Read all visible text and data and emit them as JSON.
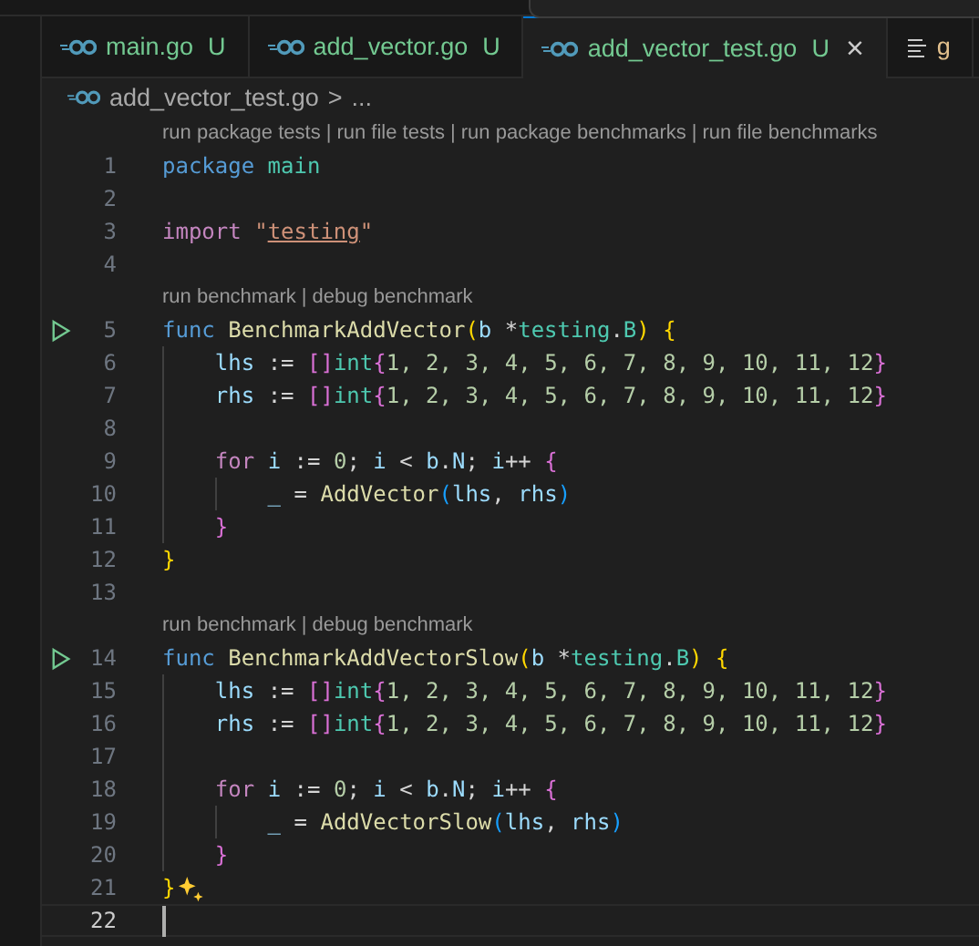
{
  "tabs": [
    {
      "label": "main.go",
      "status": "U",
      "selected": false,
      "kind": "go-file"
    },
    {
      "label": "add_vector.go",
      "status": "U",
      "selected": false,
      "kind": "go-file"
    },
    {
      "label": "add_vector_test.go",
      "status": "U",
      "selected": true,
      "kind": "go-file"
    },
    {
      "label": "g",
      "selected": false,
      "kind": "outline"
    }
  ],
  "close_glyph": "×",
  "breadcrumb": {
    "file": "add_vector_test.go",
    "separator": ">",
    "rest": "..."
  },
  "lens_separator": "|",
  "lines": [
    {
      "kind": "lens",
      "links": [
        "run package tests",
        "run file tests",
        "run package benchmarks",
        "run file benchmarks"
      ]
    },
    {
      "kind": "code",
      "number": "1",
      "current": false,
      "tokens": [
        {
          "text": "package",
          "kind": "keyword"
        },
        {
          "text": " main",
          "kind": "type"
        }
      ]
    },
    {
      "kind": "code",
      "number": "2",
      "current": false
    },
    {
      "kind": "code",
      "number": "3",
      "current": false,
      "tokens": [
        {
          "text": "import",
          "kind": "control"
        },
        {
          "text": " \"",
          "kind": "string"
        },
        {
          "text": "testing",
          "kind": "link"
        },
        {
          "text": "\"",
          "kind": "string"
        }
      ]
    },
    {
      "kind": "code",
      "number": "4",
      "current": false
    },
    {
      "kind": "lens",
      "links": [
        "run benchmark",
        "debug benchmark"
      ]
    },
    {
      "kind": "code",
      "number": "5",
      "runnable": true,
      "current": false,
      "tokens": [
        {
          "text": "func",
          "kind": "keyword"
        },
        {
          "text": " BenchmarkAddVector",
          "kind": "function"
        },
        {
          "text": "(",
          "kind": "bracket1"
        },
        {
          "text": "b",
          "kind": "variable"
        },
        {
          "text": " *",
          "kind": "op"
        },
        {
          "text": "testing",
          "kind": "type"
        },
        {
          "text": ".",
          "kind": "op"
        },
        {
          "text": "B",
          "kind": "type"
        },
        {
          "text": ")",
          "kind": "bracket1"
        },
        {
          "text": " {",
          "kind": "bracket1"
        }
      ]
    },
    {
      "kind": "code",
      "number": "6",
      "current": false,
      "tokens": [
        {
          "text": "    lhs",
          "kind": "variable"
        },
        {
          "text": " := ",
          "kind": "op"
        },
        {
          "text": "[]",
          "kind": "bracket2"
        },
        {
          "text": "int",
          "kind": "type"
        },
        {
          "text": "{",
          "kind": "bracket2"
        },
        {
          "text": "1, 2, 3, 4, 5, 6, 7, 8, 9, 10, 11, 12",
          "kind": "number"
        },
        {
          "text": "}",
          "kind": "bracket2"
        }
      ]
    },
    {
      "kind": "code",
      "number": "7",
      "current": false,
      "tokens": [
        {
          "text": "    rhs",
          "kind": "variable"
        },
        {
          "text": " := ",
          "kind": "op"
        },
        {
          "text": "[]",
          "kind": "bracket2"
        },
        {
          "text": "int",
          "kind": "type"
        },
        {
          "text": "{",
          "kind": "bracket2"
        },
        {
          "text": "1, 2, 3, 4, 5, 6, 7, 8, 9, 10, 11, 12",
          "kind": "number"
        },
        {
          "text": "}",
          "kind": "bracket2"
        }
      ]
    },
    {
      "kind": "code",
      "number": "8",
      "current": false
    },
    {
      "kind": "code",
      "number": "9",
      "current": false,
      "tokens": [
        {
          "text": "    for",
          "kind": "control"
        },
        {
          "text": " i",
          "kind": "variable"
        },
        {
          "text": " := ",
          "kind": "op"
        },
        {
          "text": "0",
          "kind": "number"
        },
        {
          "text": "; ",
          "kind": "op"
        },
        {
          "text": "i",
          "kind": "variable"
        },
        {
          "text": " < ",
          "kind": "op"
        },
        {
          "text": "b",
          "kind": "variable"
        },
        {
          "text": ".",
          "kind": "op"
        },
        {
          "text": "N",
          "kind": "variable"
        },
        {
          "text": "; ",
          "kind": "op"
        },
        {
          "text": "i",
          "kind": "variable"
        },
        {
          "text": "++ ",
          "kind": "op"
        },
        {
          "text": "{",
          "kind": "bracket2"
        }
      ]
    },
    {
      "kind": "code",
      "number": "10",
      "current": false,
      "tokens": [
        {
          "text": "        _",
          "kind": "variable"
        },
        {
          "text": " = ",
          "kind": "op"
        },
        {
          "text": "AddVector",
          "kind": "function"
        },
        {
          "text": "(",
          "kind": "bracket3"
        },
        {
          "text": "lhs",
          "kind": "variable"
        },
        {
          "text": ", ",
          "kind": "op"
        },
        {
          "text": "rhs",
          "kind": "variable"
        },
        {
          "text": ")",
          "kind": "bracket3"
        }
      ]
    },
    {
      "kind": "code",
      "number": "11",
      "current": false,
      "tokens": [
        {
          "text": "    }",
          "kind": "bracket2"
        }
      ]
    },
    {
      "kind": "code",
      "number": "12",
      "current": false,
      "tokens": [
        {
          "text": "}",
          "kind": "bracket1"
        }
      ]
    },
    {
      "kind": "code",
      "number": "13",
      "current": false
    },
    {
      "kind": "lens",
      "links": [
        "run benchmark",
        "debug benchmark"
      ]
    },
    {
      "kind": "code",
      "number": "14",
      "runnable": true,
      "current": false,
      "tokens": [
        {
          "text": "func",
          "kind": "keyword"
        },
        {
          "text": " BenchmarkAddVectorSlow",
          "kind": "function"
        },
        {
          "text": "(",
          "kind": "bracket1"
        },
        {
          "text": "b",
          "kind": "variable"
        },
        {
          "text": " *",
          "kind": "op"
        },
        {
          "text": "testing",
          "kind": "type"
        },
        {
          "text": ".",
          "kind": "op"
        },
        {
          "text": "B",
          "kind": "type"
        },
        {
          "text": ")",
          "kind": "bracket1"
        },
        {
          "text": " {",
          "kind": "bracket1"
        }
      ]
    },
    {
      "kind": "code",
      "number": "15",
      "current": false,
      "tokens": [
        {
          "text": "    lhs",
          "kind": "variable"
        },
        {
          "text": " := ",
          "kind": "op"
        },
        {
          "text": "[]",
          "kind": "bracket2"
        },
        {
          "text": "int",
          "kind": "type"
        },
        {
          "text": "{",
          "kind": "bracket2"
        },
        {
          "text": "1, 2, 3, 4, 5, 6, 7, 8, 9, 10, 11, 12",
          "kind": "number"
        },
        {
          "text": "}",
          "kind": "bracket2"
        }
      ]
    },
    {
      "kind": "code",
      "number": "16",
      "current": false,
      "tokens": [
        {
          "text": "    rhs",
          "kind": "variable"
        },
        {
          "text": " := ",
          "kind": "op"
        },
        {
          "text": "[]",
          "kind": "bracket2"
        },
        {
          "text": "int",
          "kind": "type"
        },
        {
          "text": "{",
          "kind": "bracket2"
        },
        {
          "text": "1, 2, 3, 4, 5, 6, 7, 8, 9, 10, 11, 12",
          "kind": "number"
        },
        {
          "text": "}",
          "kind": "bracket2"
        }
      ]
    },
    {
      "kind": "code",
      "number": "17",
      "current": false
    },
    {
      "kind": "code",
      "number": "18",
      "current": false,
      "tokens": [
        {
          "text": "    for",
          "kind": "control"
        },
        {
          "text": " i",
          "kind": "variable"
        },
        {
          "text": " := ",
          "kind": "op"
        },
        {
          "text": "0",
          "kind": "number"
        },
        {
          "text": "; ",
          "kind": "op"
        },
        {
          "text": "i",
          "kind": "variable"
        },
        {
          "text": " < ",
          "kind": "op"
        },
        {
          "text": "b",
          "kind": "variable"
        },
        {
          "text": ".",
          "kind": "op"
        },
        {
          "text": "N",
          "kind": "variable"
        },
        {
          "text": "; ",
          "kind": "op"
        },
        {
          "text": "i",
          "kind": "variable"
        },
        {
          "text": "++ ",
          "kind": "op"
        },
        {
          "text": "{",
          "kind": "bracket2"
        }
      ]
    },
    {
      "kind": "code",
      "number": "19",
      "current": false,
      "tokens": [
        {
          "text": "        _",
          "kind": "variable"
        },
        {
          "text": " = ",
          "kind": "op"
        },
        {
          "text": "AddVectorSlow",
          "kind": "function"
        },
        {
          "text": "(",
          "kind": "bracket3"
        },
        {
          "text": "lhs",
          "kind": "variable"
        },
        {
          "text": ", ",
          "kind": "op"
        },
        {
          "text": "rhs",
          "kind": "variable"
        },
        {
          "text": ")",
          "kind": "bracket3"
        }
      ]
    },
    {
      "kind": "code",
      "number": "20",
      "current": false,
      "tokens": [
        {
          "text": "    }",
          "kind": "bracket2"
        }
      ]
    },
    {
      "kind": "code",
      "number": "21",
      "current": false,
      "sparkle": true,
      "tokens": [
        {
          "text": "}",
          "kind": "bracket1"
        }
      ]
    },
    {
      "kind": "code",
      "number": "22",
      "current": true
    }
  ]
}
